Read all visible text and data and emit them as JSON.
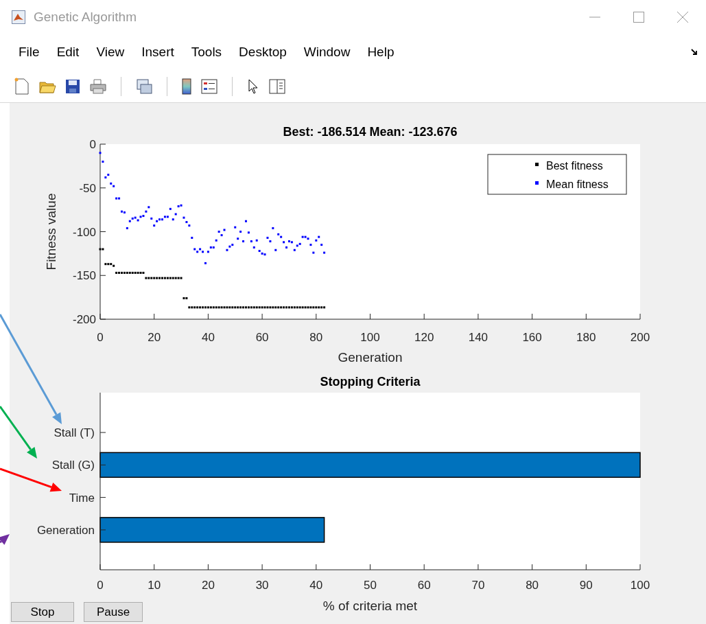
{
  "window": {
    "title": "Genetic Algorithm"
  },
  "menu": [
    "File",
    "Edit",
    "View",
    "Insert",
    "Tools",
    "Desktop",
    "Window",
    "Help"
  ],
  "fitness_plot": {
    "chart_data": {
      "type": "scatter",
      "legend": "top right",
      "title": "Best: -186.514 Mean: -123.676",
      "xlabel": "Generation",
      "ylabel": "Fitness value",
      "xlim": [
        0,
        200
      ],
      "ylim": [
        -200,
        0
      ],
      "xticks": [
        0,
        20,
        40,
        60,
        80,
        100,
        120,
        140,
        160,
        180,
        200
      ],
      "yticks": [
        -200,
        -150,
        -100,
        -50,
        0
      ],
      "x": [
        0,
        1,
        2,
        3,
        4,
        5,
        6,
        7,
        8,
        9,
        10,
        11,
        12,
        13,
        14,
        15,
        16,
        17,
        18,
        19,
        20,
        21,
        22,
        23,
        24,
        25,
        26,
        27,
        28,
        29,
        30,
        31,
        32,
        33,
        34,
        35,
        36,
        37,
        38,
        39,
        40,
        41,
        42,
        43,
        44,
        45,
        46,
        47,
        48,
        49,
        50,
        51,
        52,
        53,
        54,
        55,
        56,
        57,
        58,
        59,
        60,
        61,
        62,
        63,
        64,
        65,
        66,
        67,
        68,
        69,
        70,
        71,
        72,
        73,
        74,
        75,
        76,
        77,
        78,
        79,
        80,
        81,
        82,
        83
      ],
      "series": [
        {
          "name": "Best fitness",
          "color": "#000000",
          "values": [
            -120,
            -120,
            -137,
            -137,
            -137,
            -139,
            -147,
            -147,
            -147,
            -147,
            -147,
            -147,
            -147,
            -147,
            -147,
            -147,
            -147,
            -153,
            -153,
            -153,
            -153,
            -153,
            -153,
            -153,
            -153,
            -153,
            -153,
            -153,
            -153,
            -153,
            -153,
            -176,
            -176,
            -186.5,
            -186.5,
            -186.5,
            -186.5,
            -186.5,
            -186.5,
            -186.5,
            -186.5,
            -186.5,
            -186.5,
            -186.5,
            -186.5,
            -186.5,
            -186.5,
            -186.5,
            -186.5,
            -186.5,
            -186.5,
            -186.5,
            -186.5,
            -186.5,
            -186.5,
            -186.5,
            -186.5,
            -186.5,
            -186.5,
            -186.5,
            -186.5,
            -186.5,
            -186.5,
            -186.5,
            -186.5,
            -186.5,
            -186.5,
            -186.5,
            -186.5,
            -186.5,
            -186.5,
            -186.5,
            -186.5,
            -186.5,
            -186.5,
            -186.5,
            -186.5,
            -186.5,
            -186.5,
            -186.5,
            -186.5,
            -186.5,
            -186.5,
            -186.5
          ]
        },
        {
          "name": "Mean fitness",
          "color": "#0000ff",
          "values": [
            -10,
            -20,
            -38,
            -35,
            -45,
            -48,
            -62,
            -62,
            -77,
            -78,
            -96,
            -88,
            -85,
            -84,
            -87,
            -83,
            -82,
            -77,
            -72,
            -85,
            -93,
            -88,
            -86,
            -86,
            -83,
            -83,
            -74,
            -86,
            -80,
            -71,
            -70,
            -84,
            -89,
            -93,
            -107,
            -120,
            -123,
            -120,
            -123,
            -136,
            -123,
            -118,
            -118,
            -110,
            -100,
            -104,
            -98,
            -121,
            -117,
            -115,
            -95,
            -108,
            -100,
            -111,
            -88,
            -101,
            -111,
            -118,
            -110,
            -122,
            -125,
            -126,
            -107,
            -111,
            -96,
            -121,
            -103,
            -106,
            -112,
            -118,
            -111,
            -112,
            -121,
            -116,
            -114,
            -106,
            -106,
            -108,
            -115,
            -124,
            -110,
            -106,
            -115,
            -124
          ]
        }
      ]
    }
  },
  "criteria_plot": {
    "chart_data": {
      "type": "bar",
      "orientation": "horizontal",
      "title": "Stopping Criteria",
      "xlabel": "% of criteria met",
      "xlim": [
        0,
        100
      ],
      "xticks": [
        0,
        10,
        20,
        30,
        40,
        50,
        60,
        70,
        80,
        90,
        100
      ],
      "categories": [
        "Stall (T)",
        "Stall (G)",
        "Time",
        "Generation"
      ],
      "values": [
        0,
        100,
        0,
        41.5
      ]
    }
  },
  "buttons": [
    "Stop",
    "Pause"
  ]
}
